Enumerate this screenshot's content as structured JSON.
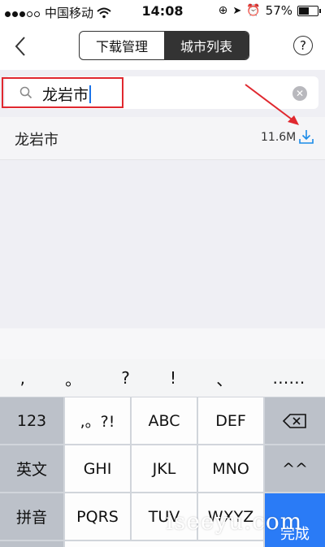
{
  "status_bar": {
    "carrier": "中国移动",
    "time": "14:08",
    "battery": "57%"
  },
  "nav": {
    "segments": [
      "下载管理",
      "城市列表"
    ],
    "active_segment": 1,
    "help_label": "?"
  },
  "search": {
    "value": "龙岩市"
  },
  "result": {
    "name": "龙岩市",
    "size": "11.6M"
  },
  "keyboard": {
    "punctuation": [
      ",",
      "。",
      "?",
      "!",
      "、",
      "……"
    ],
    "rows": [
      [
        "123",
        ",。?!",
        "ABC",
        "DEF",
        "⌫"
      ],
      [
        "英文",
        "GHI",
        "JKL",
        "MNO",
        "^^"
      ],
      [
        "拼音",
        "PQRS",
        "TUV",
        "WXYZ",
        "完成"
      ]
    ]
  },
  "watermark": "iseeyu.com",
  "colors": {
    "highlight": "#e0282f",
    "accent": "#2a7bf6",
    "download": "#1a8be8"
  }
}
